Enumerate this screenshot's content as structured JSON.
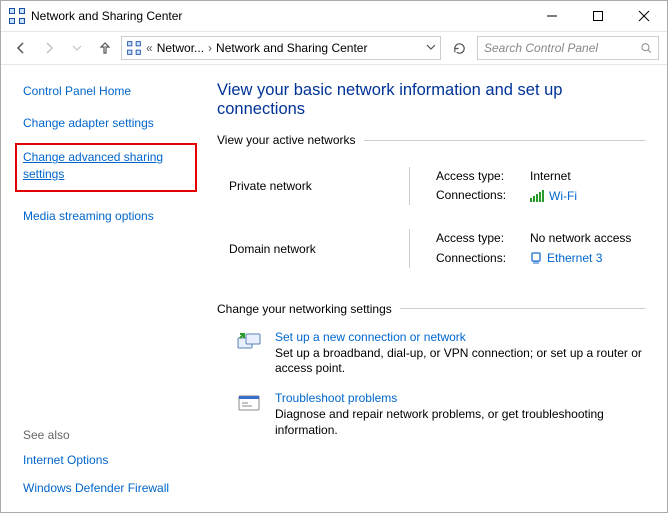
{
  "window": {
    "title": "Network and Sharing Center"
  },
  "addressbar": {
    "crumb1": "Networ...",
    "crumb2": "Network and Sharing Center",
    "search_placeholder": "Search Control Panel"
  },
  "sidebar": {
    "home": "Control Panel Home",
    "adapter": "Change adapter settings",
    "advanced": "Change advanced sharing settings",
    "streaming": "Media streaming options",
    "seealso": "See also",
    "internet_options": "Internet Options",
    "firewall": "Windows Defender Firewall"
  },
  "content": {
    "title": "View your basic network information and set up connections",
    "active_legend": "View your active networks",
    "net1": {
      "name": "Private network",
      "access_k": "Access type:",
      "access_v": "Internet",
      "conn_k": "Connections:",
      "conn_v": "Wi-Fi"
    },
    "net2": {
      "name": "Domain network",
      "access_k": "Access type:",
      "access_v": "No network access",
      "conn_k": "Connections:",
      "conn_v": "Ethernet 3"
    },
    "settings_legend": "Change your networking settings",
    "s1_title": "Set up a new connection or network",
    "s1_desc": "Set up a broadband, dial-up, or VPN connection; or set up a router or access point.",
    "s2_title": "Troubleshoot problems",
    "s2_desc": "Diagnose and repair network problems, or get troubleshooting information."
  }
}
